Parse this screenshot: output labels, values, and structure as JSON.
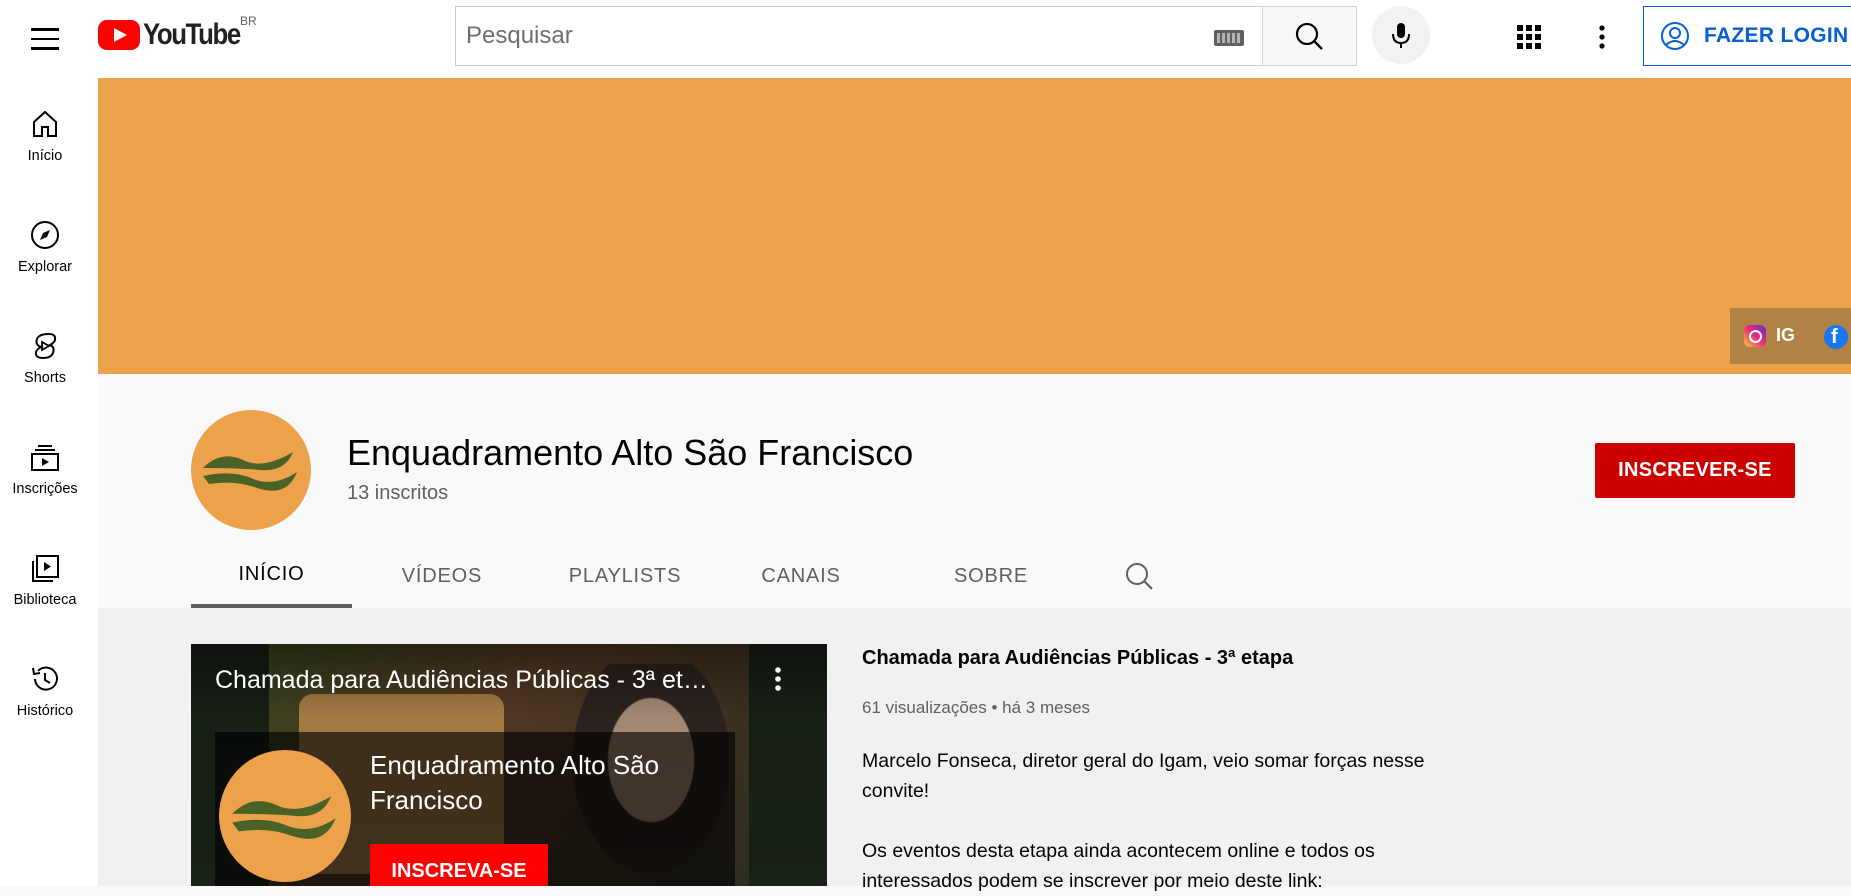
{
  "masthead": {
    "logo_text": "YouTube",
    "region": "BR",
    "search_placeholder": "Pesquisar",
    "login_label": "FAZER LOGIN"
  },
  "sidebar": {
    "items": [
      {
        "label": "Início",
        "icon": "home-icon"
      },
      {
        "label": "Explorar",
        "icon": "compass-icon"
      },
      {
        "label": "Shorts",
        "icon": "shorts-icon"
      },
      {
        "label": "Inscrições",
        "icon": "subscriptions-icon"
      },
      {
        "label": "Biblioteca",
        "icon": "library-icon"
      },
      {
        "label": "Histórico",
        "icon": "history-icon"
      }
    ]
  },
  "banner": {
    "color": "#eca24b",
    "links": [
      {
        "label": "IG",
        "icon": "instagram-icon"
      },
      {
        "label": "",
        "icon": "facebook-icon"
      }
    ]
  },
  "channel": {
    "name": "Enquadramento Alto São Francisco",
    "subscribers": "13 inscritos",
    "subscribe_label": "INSCREVER-SE",
    "subscribe_color": "#cc0000"
  },
  "tabs": [
    {
      "label": "INÍCIO",
      "active": true
    },
    {
      "label": "VÍDEOS",
      "active": false
    },
    {
      "label": "PLAYLISTS",
      "active": false
    },
    {
      "label": "CANAIS",
      "active": false
    },
    {
      "label": "SOBRE",
      "active": false
    }
  ],
  "featured": {
    "overlay_title": "Chamada para Audiências Públicas - 3ª et…",
    "card_channel": "Enquadramento Alto São Francisco",
    "card_subscribe_label": "INSCREVA-SE",
    "title": "Chamada para Audiências Públicas - 3ª etapa",
    "views": "61 visualizações",
    "age": "há 3 meses",
    "description_1": "Marcelo Fonseca, diretor geral do Igam, veio somar forças nesse convite!",
    "description_2": "Os eventos desta etapa ainda acontecem online e todos os interessados podem se inscrever por meio deste link:"
  }
}
